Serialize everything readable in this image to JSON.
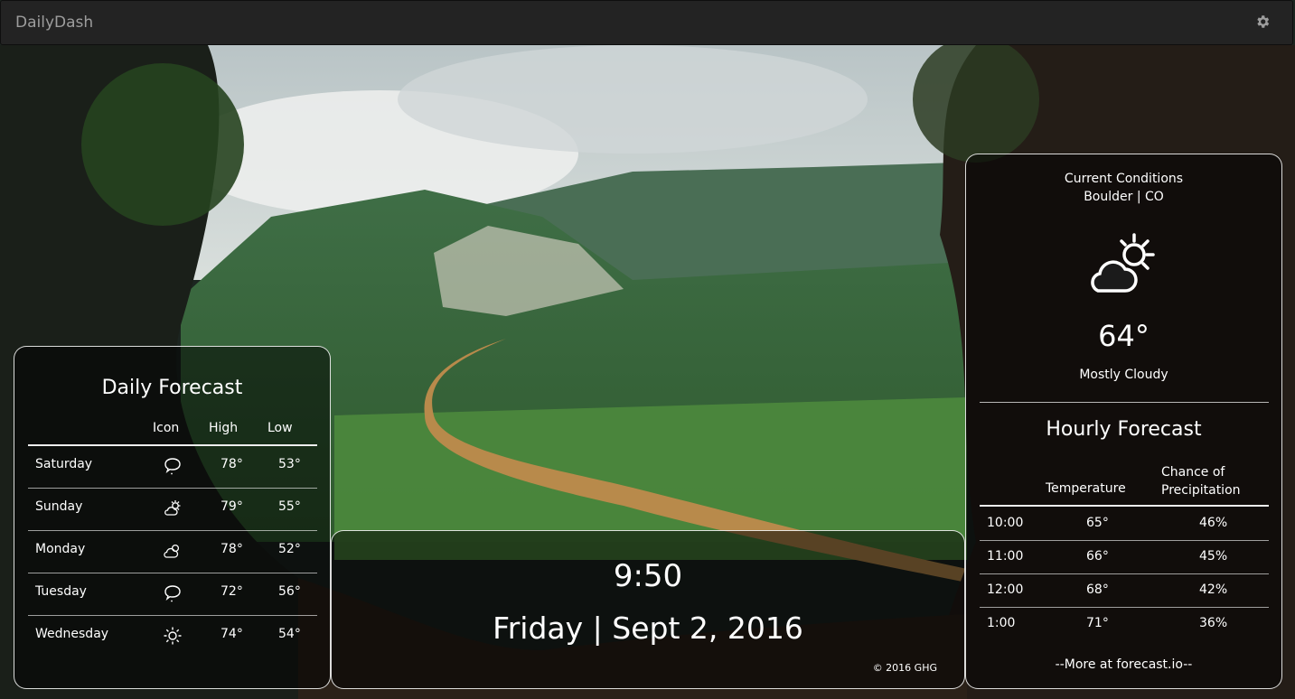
{
  "app": {
    "title": "DailyDash",
    "settings_icon": "gear-icon"
  },
  "daily": {
    "title": "Daily Forecast",
    "columns": [
      "Icon",
      "High",
      "Low"
    ],
    "rows": [
      {
        "day": "Saturday",
        "icon": "speech-bubble-cloud-icon",
        "high": "78°",
        "low": "53°"
      },
      {
        "day": "Sunday",
        "icon": "partly-sunny-icon",
        "high": "79°",
        "low": "55°"
      },
      {
        "day": "Monday",
        "icon": "partly-cloudy-icon",
        "high": "78°",
        "low": "52°"
      },
      {
        "day": "Tuesday",
        "icon": "speech-bubble-cloud-icon",
        "high": "72°",
        "low": "56°"
      },
      {
        "day": "Wednesday",
        "icon": "sun-icon",
        "high": "74°",
        "low": "54°"
      }
    ]
  },
  "center": {
    "time": "9:50",
    "date": "Friday | Sept 2, 2016",
    "copyright": "© 2016 GHG"
  },
  "current": {
    "heading": "Current Conditions",
    "location": "Boulder | CO",
    "icon": "partly-cloudy-day-icon",
    "temperature": "64°",
    "summary": "Mostly Cloudy"
  },
  "hourly": {
    "title": "Hourly Forecast",
    "col_temperature": "Temperature",
    "col_precip_line1": "Chance of",
    "col_precip_line2": "Precipitation",
    "rows": [
      {
        "time": "10:00",
        "temp": "65°",
        "precip": "46%"
      },
      {
        "time": "11:00",
        "temp": "66°",
        "precip": "45%"
      },
      {
        "time": "12:00",
        "temp": "68°",
        "precip": "42%"
      },
      {
        "time": "1:00",
        "temp": "71°",
        "precip": "36%"
      }
    ],
    "more_link": "--More at forecast.io--"
  }
}
